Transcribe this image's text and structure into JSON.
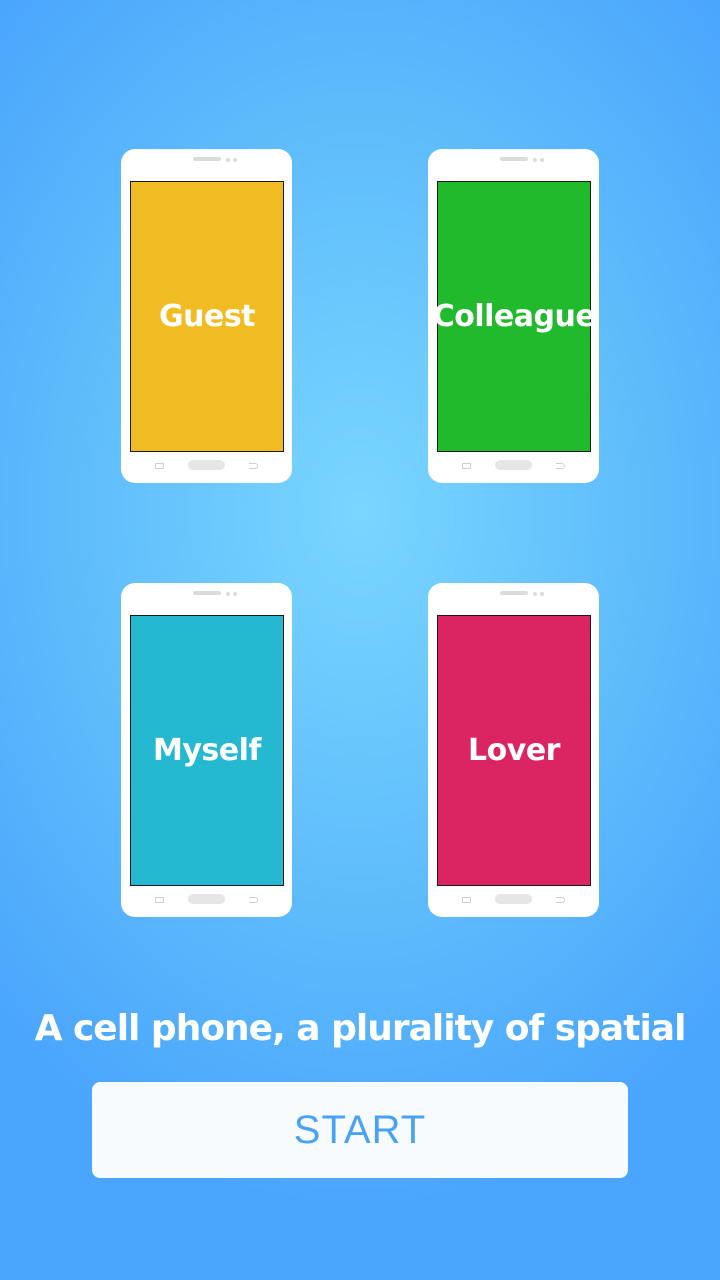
{
  "colors": {
    "background_center": "#79d6ff",
    "background_edge": "#4aa5fd",
    "start_label": "#4aa3f2"
  },
  "phones": [
    {
      "id": "guest",
      "label": "Guest",
      "screen_color": "#f0bc21"
    },
    {
      "id": "colleague",
      "label": "Colleague",
      "screen_color": "#20ba2c"
    },
    {
      "id": "myself",
      "label": "Myself",
      "screen_color": "#25b8d1"
    },
    {
      "id": "lover",
      "label": "Lover",
      "screen_color": "#db2563"
    }
  ],
  "tagline": "A cell phone, a plurality of spatial",
  "start_button": {
    "label": "START"
  }
}
